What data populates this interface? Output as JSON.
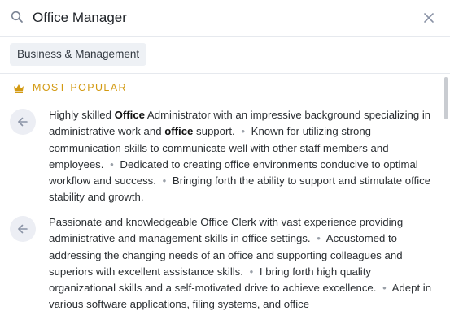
{
  "search": {
    "value": "Office Manager"
  },
  "filters": {
    "active_chip": "Business & Management"
  },
  "section": {
    "title": "MOST POPULAR"
  },
  "results": [
    {
      "segments": [
        {
          "text": "Highly skilled ",
          "bold": false
        },
        {
          "text": "Office",
          "bold": true
        },
        {
          "text": " Administrator with an impressive background specializing in administrative work and ",
          "bold": false
        },
        {
          "text": "office",
          "bold": true
        },
        {
          "text": " support.",
          "bold": false
        },
        {
          "sep": "•"
        },
        {
          "text": "Known for utilizing strong communication skills to communicate well with other staff members and employees.",
          "bold": false
        },
        {
          "sep": "•"
        },
        {
          "text": "Dedicated to creating office environments conducive to optimal workflow and success.",
          "bold": false
        },
        {
          "sep": "•"
        },
        {
          "text": "Bringing forth the ability to support and stimulate office stability and growth.",
          "bold": false
        }
      ]
    },
    {
      "segments": [
        {
          "text": "Passionate and knowledgeable Office Clerk with vast experience providing administrative and management skills in office settings.",
          "bold": false
        },
        {
          "sep": "•"
        },
        {
          "text": "Accustomed to addressing the changing needs of an office and supporting colleagues and superiors with excellent assistance skills.",
          "bold": false
        },
        {
          "sep": "•"
        },
        {
          "text": "I bring forth high quality organizational skills and a self-motivated drive to achieve excellence.",
          "bold": false
        },
        {
          "sep": "•"
        },
        {
          "text": "Adept in various software applications, filing systems, and office",
          "bold": false
        }
      ]
    }
  ],
  "colors": {
    "accent_gold": "#d39a12",
    "chip_bg": "#eef1f5",
    "button_bg": "#eceef4",
    "icon_gray": "#8a93a6"
  },
  "icons": {
    "search": "search-icon",
    "clear": "close-icon",
    "section": "crown-icon",
    "add": "arrow-left-icon"
  }
}
